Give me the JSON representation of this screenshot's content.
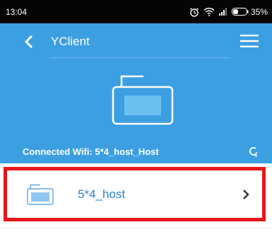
{
  "status_bar": {
    "time": "13:04",
    "battery": "35%",
    "icons": [
      "alarm-icon",
      "wifi-icon",
      "signal-icon",
      "battery-icon"
    ]
  },
  "header": {
    "title": "YClient",
    "connected_wifi": "Connected Wifi: 5*4_host_Host"
  },
  "hosts": [
    {
      "name": "5*4_host"
    }
  ],
  "colors": {
    "header_bg": "#3c9fe2",
    "status_bar_bg": "#050505",
    "highlight": "#e8151c",
    "host_text": "#2c7fcf"
  }
}
